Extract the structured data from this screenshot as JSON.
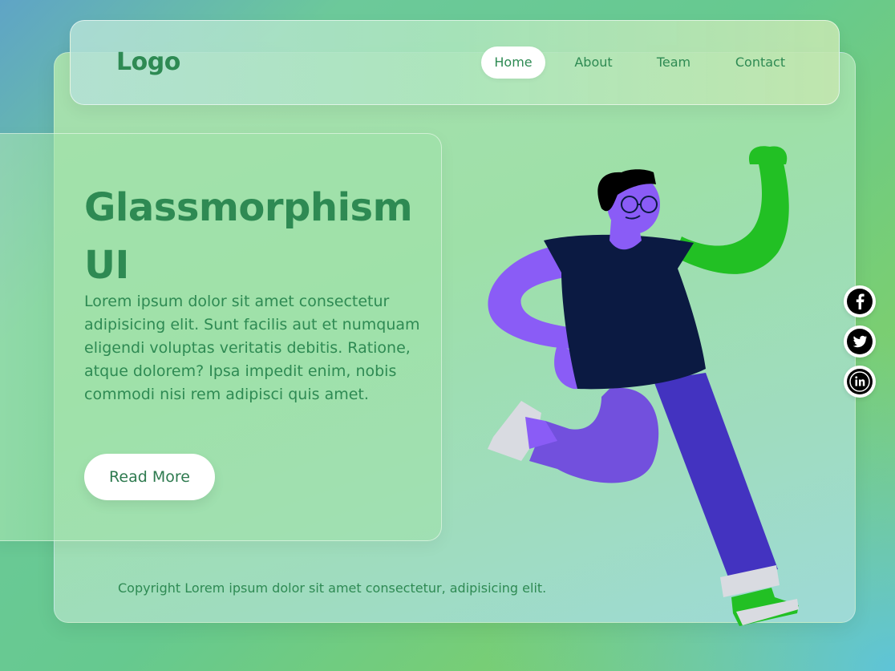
{
  "nav": {
    "logo": "Logo",
    "items": [
      {
        "label": "Home",
        "active": true
      },
      {
        "label": "About",
        "active": false
      },
      {
        "label": "Team",
        "active": false
      },
      {
        "label": "Contact",
        "active": false
      }
    ]
  },
  "hero": {
    "title": "Glassmorphism UI",
    "body": "Lorem ipsum dolor sit amet consectetur adipisicing elit. Sunt facilis aut et numquam eligendi voluptas veritatis debitis. Ratione, atque dolorem? Ipsa impedit enim, nobis commodi nisi rem adipisci quis amet.",
    "button_label": "Read More"
  },
  "footer": {
    "copyright": "Copyright Lorem ipsum dolor sit amet consectetur, adipisicing elit."
  },
  "social": [
    {
      "icon": "facebook-icon"
    },
    {
      "icon": "twitter-icon"
    },
    {
      "icon": "linkedin-icon"
    }
  ],
  "colors": {
    "text_green": "#2e8a53",
    "figure_purple": "#8a5cf6",
    "figure_shirt": "#0b1a42",
    "figure_pants": "#4333c0",
    "figure_arm": "#22c024"
  }
}
